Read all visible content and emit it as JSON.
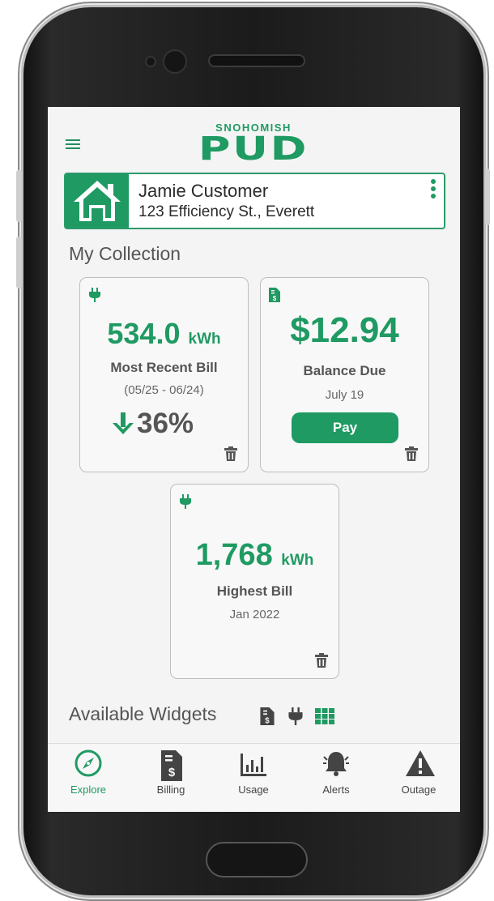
{
  "brand": {
    "top": "SNOHOMISH",
    "main": "PUD",
    "color": "#1f9a62"
  },
  "account": {
    "name": "Jamie Customer",
    "address": "123 Efficiency St., Everett"
  },
  "collection": {
    "title": "My Collection",
    "recent_bill": {
      "value": "534.0",
      "unit": "kWh",
      "label": "Most Recent Bill",
      "period": "(05/25 - 06/24)",
      "change": "36%",
      "icon": "plug-icon"
    },
    "balance": {
      "value": "$12.94",
      "label": "Balance Due",
      "due": "July 19",
      "pay_label": "Pay",
      "icon": "bill-icon"
    },
    "highest_bill": {
      "value": "1,768",
      "unit": "kWh",
      "label": "Highest Bill",
      "date": "Jan 2022",
      "icon": "plug-icon"
    }
  },
  "available_widgets": {
    "title": "Available Widgets",
    "icons": [
      "bill-icon",
      "plug-icon",
      "grid-icon"
    ]
  },
  "tabs": [
    {
      "label": "Explore",
      "icon": "compass-icon",
      "active": true
    },
    {
      "label": "Billing",
      "icon": "bill-icon",
      "active": false
    },
    {
      "label": "Usage",
      "icon": "bar-chart-icon",
      "active": false
    },
    {
      "label": "Alerts",
      "icon": "bell-icon",
      "active": false
    },
    {
      "label": "Outage",
      "icon": "warning-icon",
      "active": false
    }
  ]
}
